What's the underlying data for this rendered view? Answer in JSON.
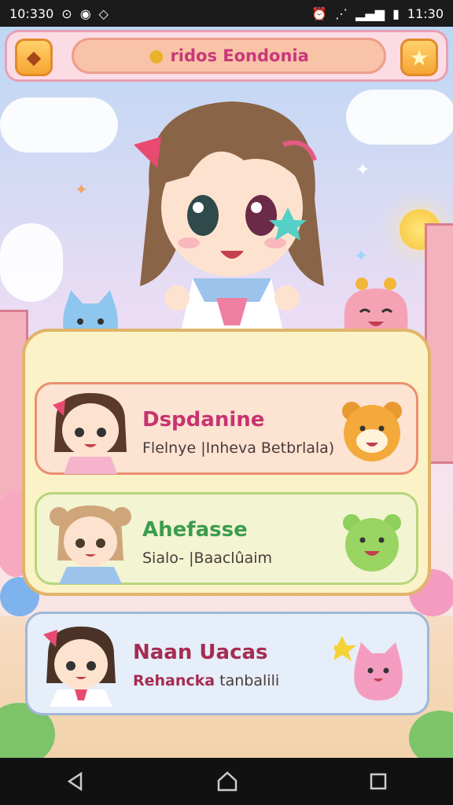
{
  "status_bar": {
    "time_left": "10:330",
    "time_right": "11:30"
  },
  "header": {
    "title": "ridos Eondonia"
  },
  "cards": [
    {
      "name": "Dspdanine",
      "subtitle": "Flelnye |Inheva Betbrlala)",
      "accent": "#c63470",
      "bg": "#fce3d2",
      "border": "#ea8f6f"
    },
    {
      "name": "Ahefasse",
      "subtitle": "Sialo- |Baaclûaim",
      "accent": "#3b9c4e",
      "bg": "#f2f4d2",
      "border": "#b9d47b"
    },
    {
      "name": "Naan Uacas",
      "subtitle_bold": "Rehancka",
      "subtitle": "tanbalili",
      "accent": "#a62c52",
      "bg": "#e5eef9",
      "border": "#9fb7d8"
    }
  ],
  "icons": {
    "back": "diamond-back-icon",
    "star": "star-icon"
  }
}
